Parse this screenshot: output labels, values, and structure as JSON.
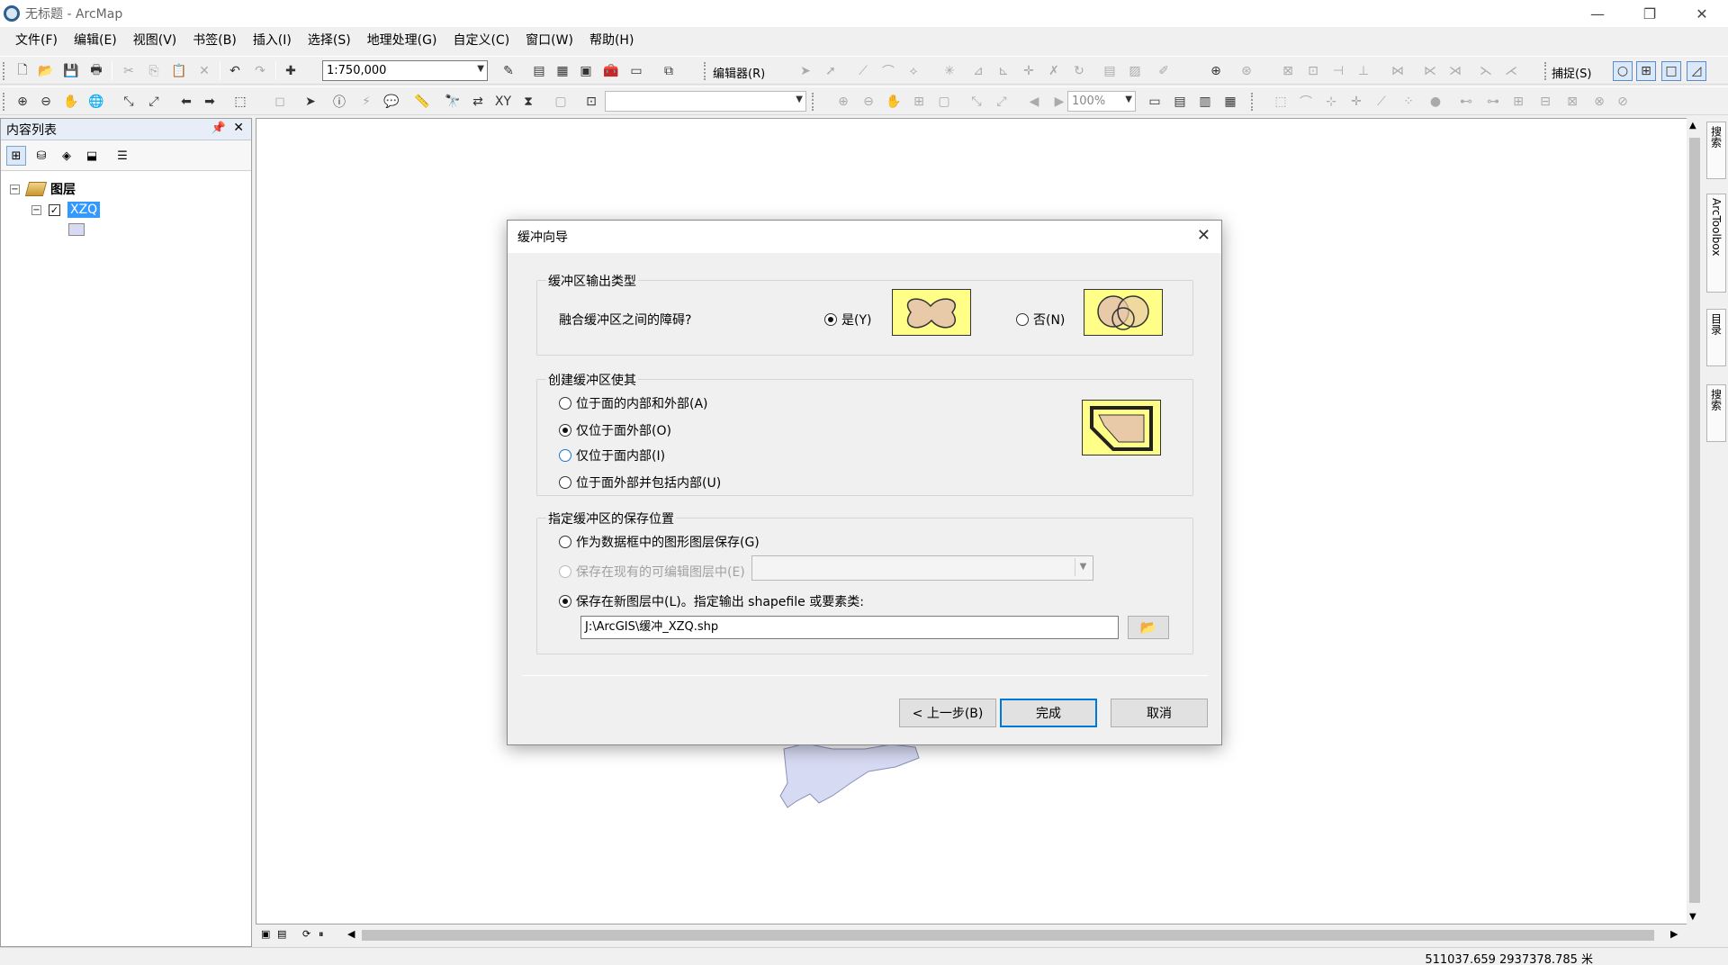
{
  "window": {
    "title": "无标题 - ArcMap"
  },
  "menu": [
    "文件(F)",
    "编辑(E)",
    "视图(V)",
    "书签(B)",
    "插入(I)",
    "选择(S)",
    "地理处理(G)",
    "自定义(C)",
    "窗口(W)",
    "帮助(H)"
  ],
  "toolbar": {
    "scale": "1:750,000",
    "editor_label": "编辑器(R)",
    "snapping_label": "捕捉(S)",
    "zoom_percent": "100%"
  },
  "toc": {
    "title": "内容列表",
    "root_label": "图层",
    "layer_name": "XZQ",
    "layer_checked": "✓"
  },
  "status": {
    "coords": "511037.659  2937378.785 米"
  },
  "dock_tabs": [
    "搜索",
    "ArcToolbox",
    "目录",
    "搜索"
  ],
  "dialog": {
    "title": "缓冲向导",
    "output_type": {
      "title": "缓冲区输出类型",
      "question": "融合缓冲区之间的障碍?",
      "yes_label": "是(Y)",
      "no_label": "否(N)",
      "selected": "yes"
    },
    "create_buffer": {
      "title": "创建缓冲区使其",
      "options": [
        "位于面的内部和外部(A)",
        "仅位于面外部(O)",
        "仅位于面内部(I)",
        "位于面外部并包括内部(U)"
      ],
      "selected_index": 1
    },
    "save_location": {
      "title": "指定缓冲区的保存位置",
      "options": [
        "作为数据框中的图形图层保存(G)",
        "保存在现有的可编辑图层中(E)",
        "保存在新图层中(L)。指定输出 shapefile 或要素类:"
      ],
      "selected_index": 2,
      "output_path": "J:\\ArcGIS\\缓冲_XZQ.shp"
    },
    "buttons": {
      "back": "< 上一步(B)",
      "finish": "完成",
      "cancel": "取消"
    }
  },
  "colors": {
    "accent": "#0078d7",
    "selection": "#3399ff",
    "preview_fill": "#ffff88",
    "shape_fill": "#e8c9a8",
    "map_polygon": "#d6daf2"
  }
}
